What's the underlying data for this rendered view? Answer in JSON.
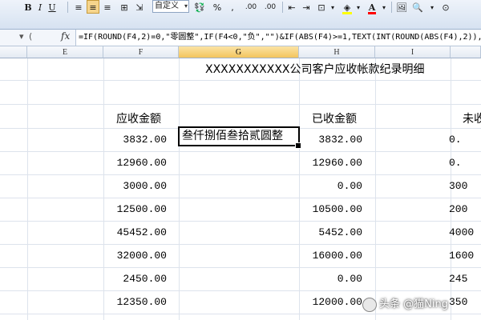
{
  "toolbar": {
    "bold": "B",
    "italic": "I",
    "underline": "U",
    "number_format": "自定义",
    "percent": "%",
    "comma": ",",
    "increase_decimal": ".00",
    "decrease_decimal": ".00",
    "font_color_letter": "A",
    "dropdown_glyph": "▾"
  },
  "formula_bar": {
    "dropdown": "▾",
    "fx": "fx",
    "formula": "=IF(ROUND(F4,2)=0,\"零圆整\",IF(F4<0,\"负\",\"\")&IF(ABS(F4)>=1,TEXT(INT(ROUND(ABS(F4),2)),"
  },
  "columns": [
    "E",
    "F",
    "G",
    "H",
    "I"
  ],
  "sheet": {
    "title": "XXXXXXXXXXX公司客户应收帐款纪录明细",
    "header_receivable": "应收金额",
    "header_received": "已收金额",
    "header_unreceived_partial": "未收",
    "receivable": [
      "3832.00",
      "12960.00",
      "3000.00",
      "12500.00",
      "45452.00",
      "32000.00",
      "2450.00",
      "12350.00"
    ],
    "received": [
      "3832.00",
      "12960.00",
      "0.00",
      "10500.00",
      "5452.00",
      "16000.00",
      "0.00",
      "12000.00"
    ],
    "unreceived_partial": [
      "0.",
      "0.",
      "300",
      "200",
      "4000",
      "1600",
      "245",
      "350"
    ],
    "selected_cell": "叁仟捌佰叁拾贰圆整"
  },
  "watermark": "头条 @猫Ning"
}
